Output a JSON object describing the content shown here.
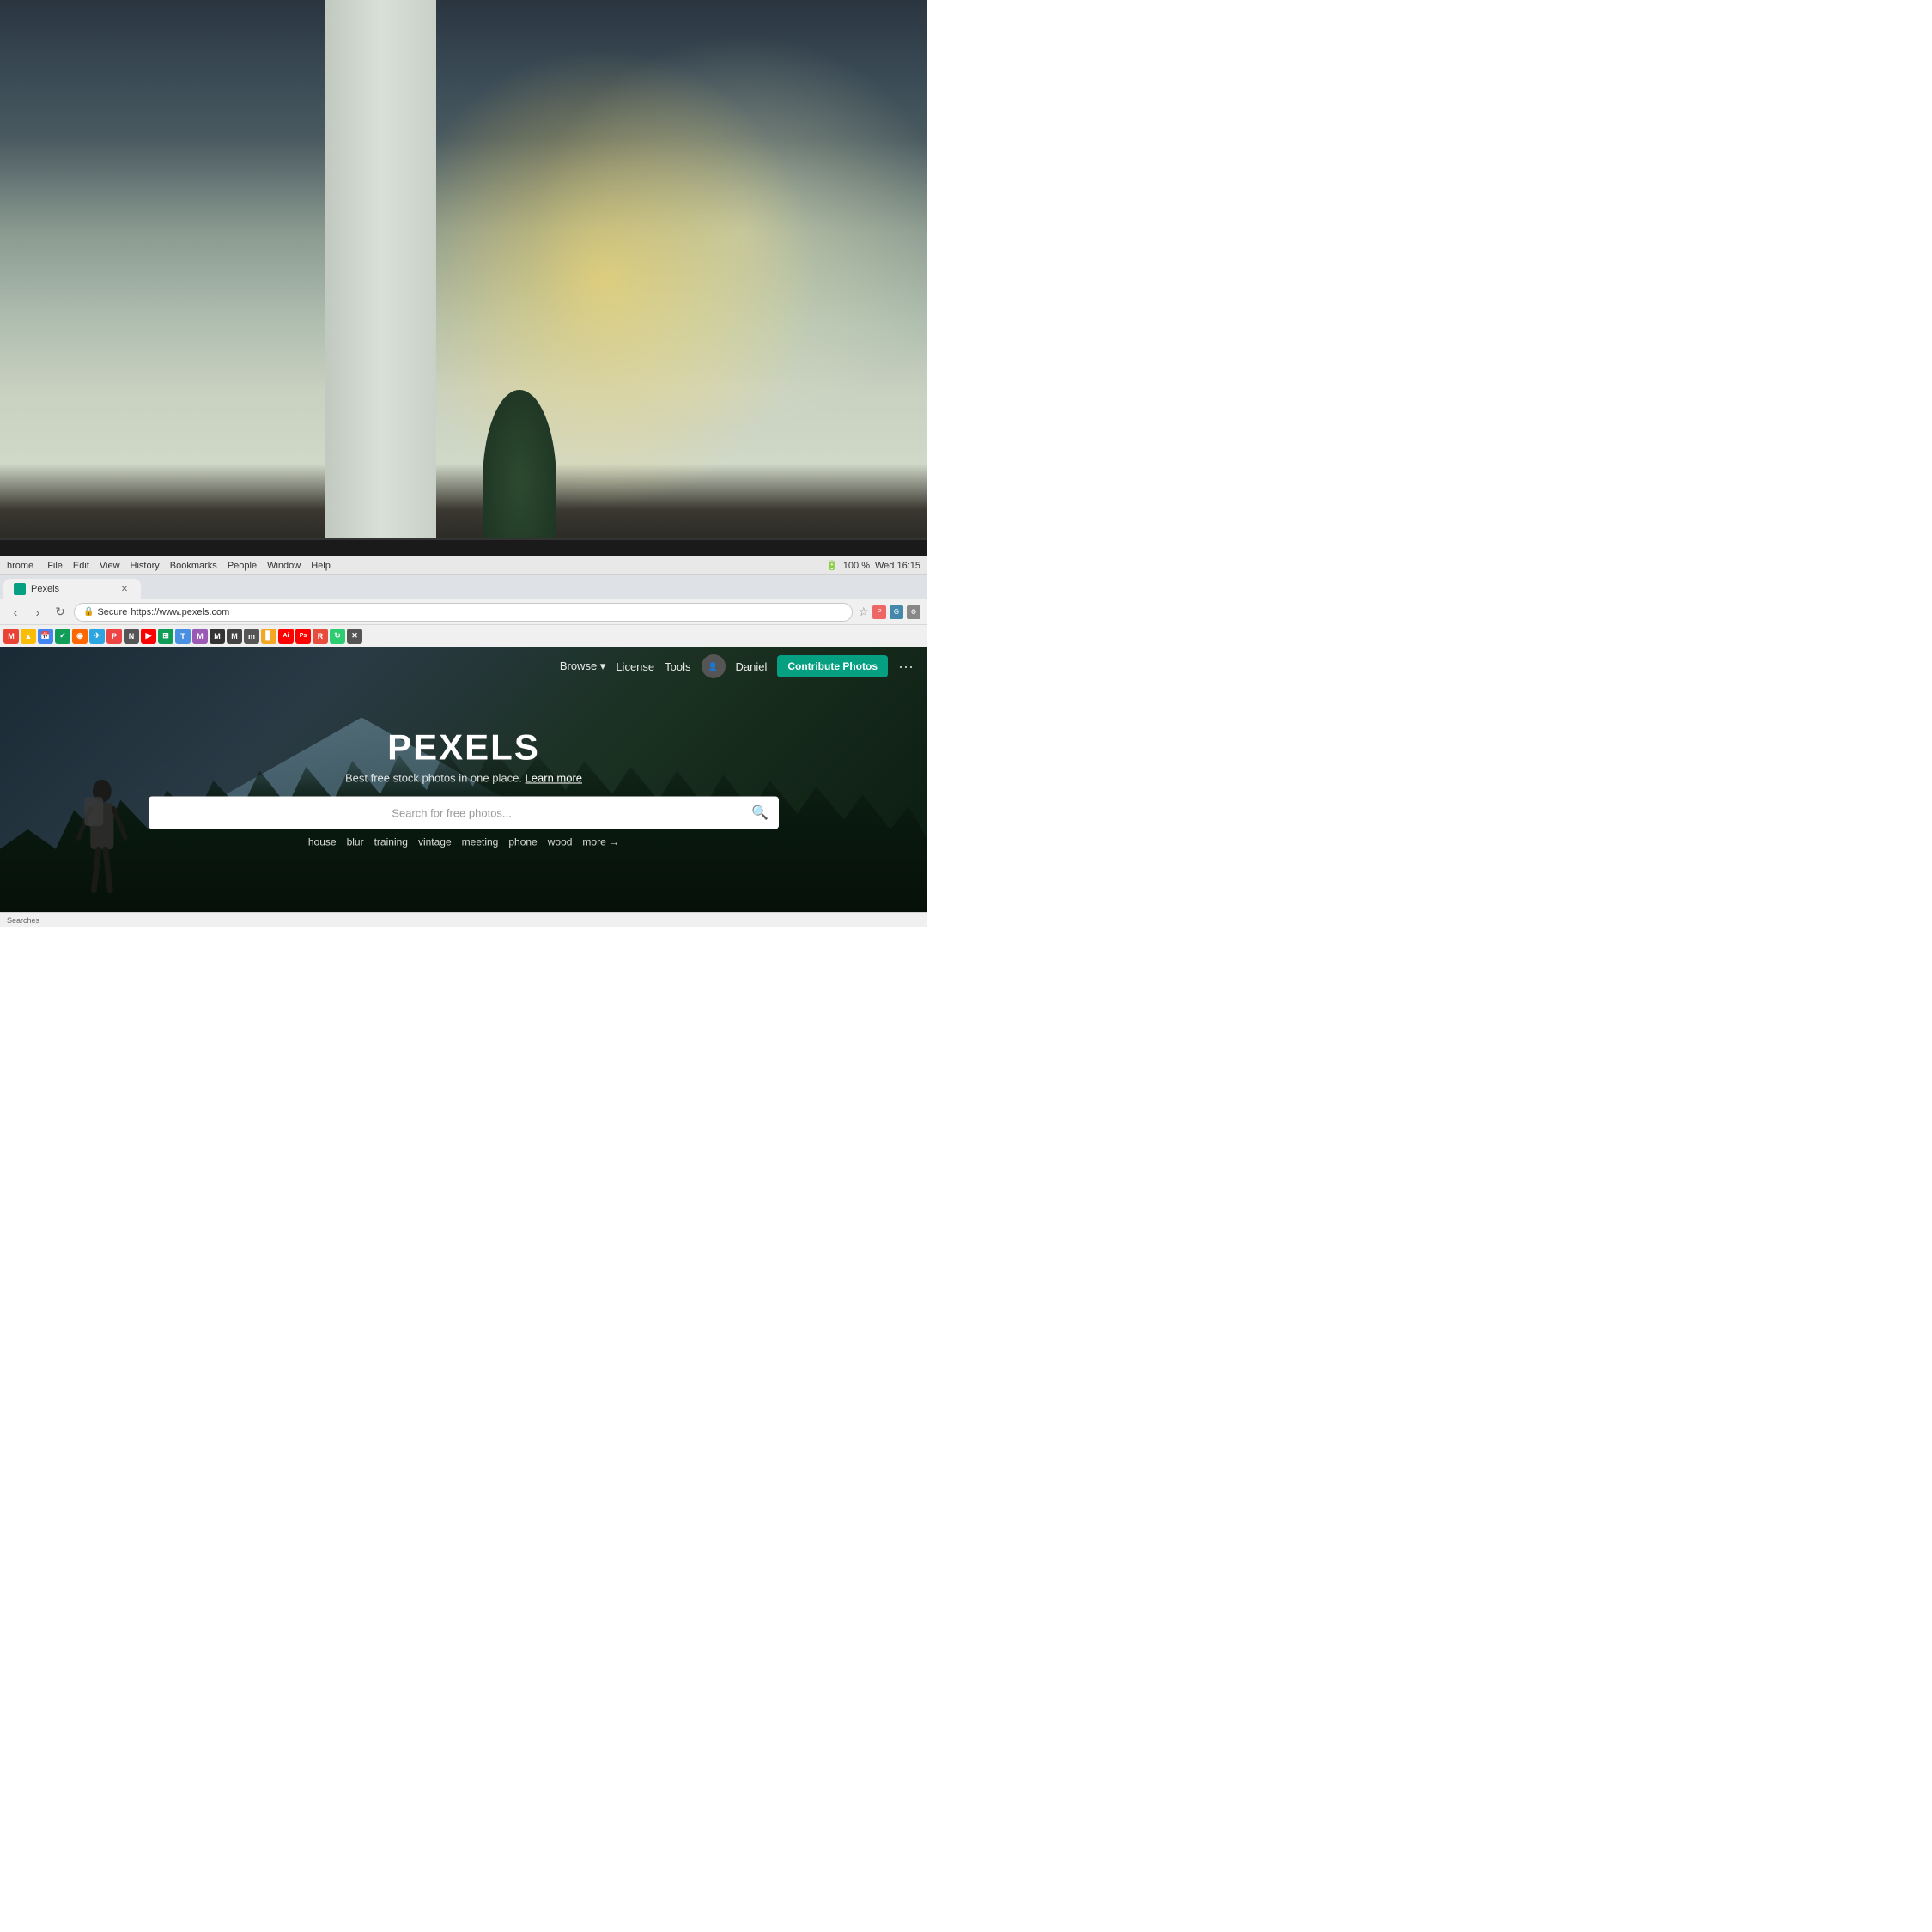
{
  "background": {
    "description": "Office/workspace blurred background photo"
  },
  "mac_menubar": {
    "app_name": "hrome",
    "menu_items": [
      "File",
      "Edit",
      "View",
      "History",
      "Bookmarks",
      "People",
      "Window",
      "Help"
    ],
    "time": "Wed 16:15",
    "battery": "100 %"
  },
  "browser": {
    "tab": {
      "title": "Pexels",
      "favicon_color": "#05a081"
    },
    "address": {
      "secure_label": "Secure",
      "url": "https://www.pexels.com"
    }
  },
  "pexels": {
    "nav": {
      "browse_label": "Browse",
      "license_label": "License",
      "tools_label": "Tools",
      "user_name": "Daniel",
      "contribute_label": "Contribute Photos",
      "more_label": "···"
    },
    "hero": {
      "logo": "PEXELS",
      "tagline": "Best free stock photos in one place.",
      "learn_more": "Learn more",
      "search_placeholder": "Search for free photos...",
      "suggestions": [
        "house",
        "blur",
        "training",
        "vintage",
        "meeting",
        "phone",
        "wood"
      ],
      "more_label": "more →"
    }
  },
  "status_bar": {
    "text": "Searches"
  }
}
